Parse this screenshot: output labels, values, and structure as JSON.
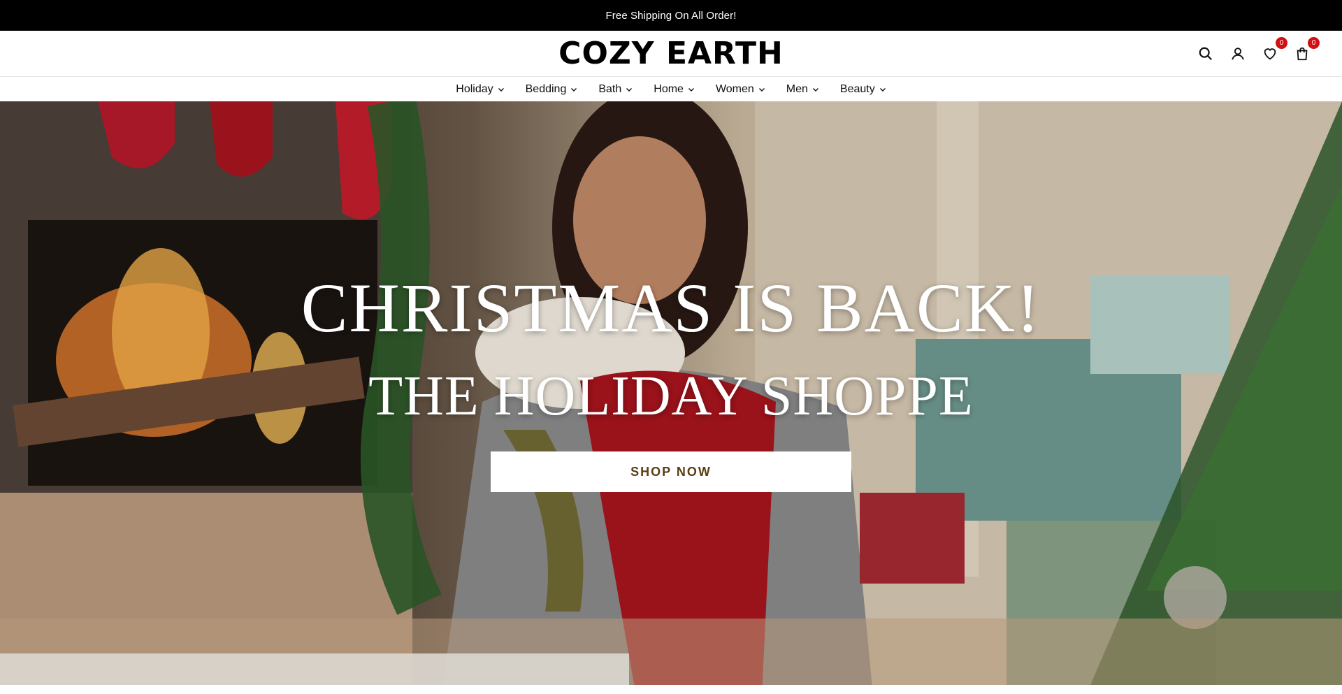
{
  "announcement": {
    "text": "Free Shipping On All Order!"
  },
  "header": {
    "logo": "COZY EARTH",
    "icons": [
      "search-icon",
      "account-icon",
      "wishlist-icon",
      "cart-icon"
    ],
    "wishlist_count": "0",
    "cart_count": "0",
    "badge_color": "#d01015"
  },
  "nav": {
    "items": [
      {
        "label": "Holiday"
      },
      {
        "label": "Bedding"
      },
      {
        "label": "Bath"
      },
      {
        "label": "Home"
      },
      {
        "label": "Women"
      },
      {
        "label": "Men"
      },
      {
        "label": "Beauty"
      }
    ]
  },
  "hero": {
    "headline": "CHRISTMAS IS BACK!",
    "subheadline": "THE HOLIDAY SHOPPE",
    "cta_label": "SHOP NOW",
    "cta_text_color": "#5a3e12"
  }
}
